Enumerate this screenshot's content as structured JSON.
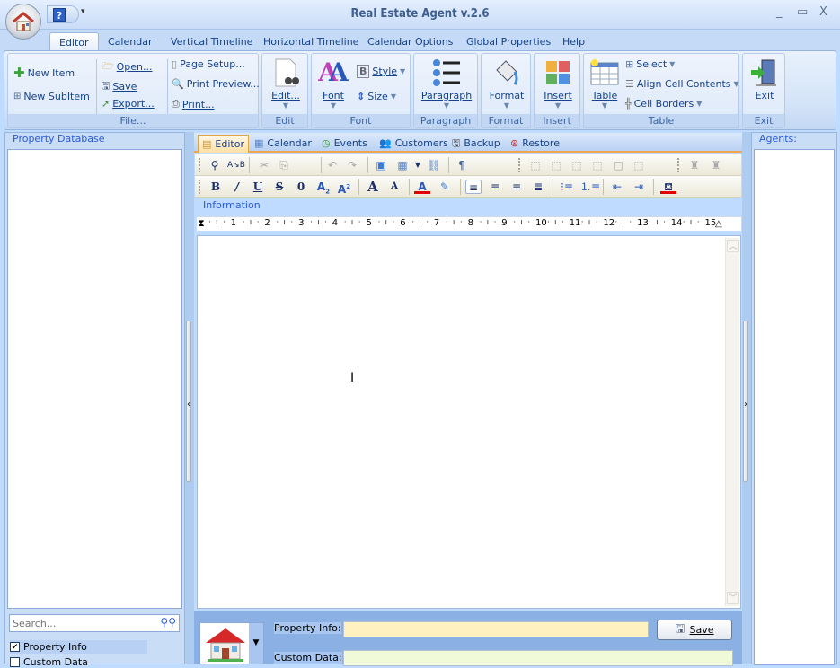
{
  "app": {
    "title": "Real Estate Agent v.2.6",
    "help_label": "?",
    "qat_more": "▾",
    "minimize": "_",
    "maximize": "▭",
    "close": "X"
  },
  "menu": {
    "tabs": [
      "Editor",
      "Calendar",
      "Vertical Timeline",
      "Horizontal Timeline",
      "Calendar Options",
      "Global Properties",
      "Help"
    ],
    "active": "Editor"
  },
  "ribbon": {
    "file": {
      "label": "File...",
      "new_item": "New Item",
      "new_subitem": "New SubItem",
      "open": "Open...",
      "save": "Save",
      "export": "Export...",
      "page_setup": "Page Setup...",
      "print_preview": "Print Preview...",
      "print": "Print..."
    },
    "edit": {
      "label": "Edit",
      "button": "Edit..."
    },
    "font": {
      "label": "Font",
      "font": "Font",
      "style": "Style",
      "size": "Size"
    },
    "paragraph": {
      "label": "Paragraph",
      "button": "Paragraph"
    },
    "format": {
      "label": "Format",
      "button": "Format"
    },
    "insert": {
      "label": "Insert",
      "button": "Insert"
    },
    "table": {
      "label": "Table",
      "table": "Table",
      "select": "Select",
      "align": "Align Cell Contents",
      "borders": "Cell Borders"
    },
    "exit": {
      "label": "Exit",
      "button": "Exit"
    }
  },
  "left_panel": {
    "title": "Property Database",
    "search_placeholder": "Search...",
    "checks": [
      {
        "label": "Property Info",
        "checked": true
      },
      {
        "label": "Custom Data",
        "checked": false
      }
    ]
  },
  "right_panel": {
    "title": "Agents:"
  },
  "doc_tabs": [
    {
      "label": "Editor",
      "active": true
    },
    {
      "label": "Calendar"
    },
    {
      "label": "Events"
    },
    {
      "label": "Customers"
    },
    {
      "label": "Backup"
    },
    {
      "label": "Restore"
    }
  ],
  "editor": {
    "section_label": "Information",
    "ruler_marks": [
      "1",
      "2",
      "3",
      "4",
      "5",
      "6",
      "7",
      "8",
      "9",
      "10",
      "11",
      "12",
      "13",
      "14",
      "15"
    ]
  },
  "bottom": {
    "property_info_label": "Property Info:",
    "property_info_value": "",
    "custom_data_label": "Custom Data:",
    "custom_data_value": "",
    "save_label": "Save"
  },
  "colors": {
    "accent": "#15428b",
    "property_field": "#fff2c0",
    "custom_field": "#f0f9d8"
  }
}
